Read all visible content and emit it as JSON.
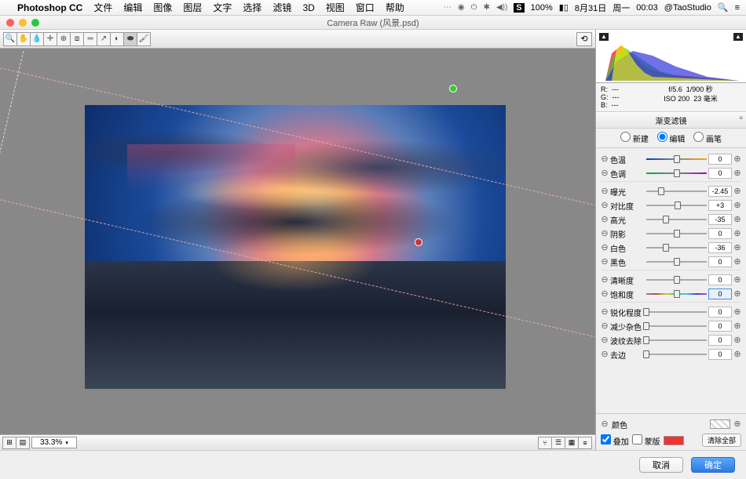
{
  "menubar": {
    "app": "Photoshop CC",
    "items": [
      "文件",
      "编辑",
      "图像",
      "图层",
      "文字",
      "选择",
      "滤镜",
      "3D",
      "视图",
      "窗口",
      "帮助"
    ],
    "status_icons": [
      "⋯",
      "◉",
      "⏻",
      "✱",
      "◀))",
      "S"
    ],
    "battery": "100%",
    "batt_icon": "▮▯",
    "date": "8月31日",
    "day": "周一",
    "time": "00:03",
    "user": "@TaoStudio"
  },
  "window": {
    "title": "Camera Raw (风景.psd)"
  },
  "toolbar": {
    "tools": [
      "zoom",
      "hand",
      "white-balance",
      "color-sampler",
      "target",
      "crop",
      "straighten",
      "spot",
      "redeye",
      "ellipse",
      "brush"
    ],
    "glyphs": [
      "🔍",
      "✋",
      "💧",
      "✛",
      "⊕",
      "⧈",
      "═",
      "↗",
      "◐",
      "⬬",
      "🖌"
    ],
    "selected_index": 9
  },
  "statusbar": {
    "grid_icons": [
      "⊞",
      "▤"
    ],
    "zoom": "33.3%",
    "right_icons": [
      "⑂",
      "☰",
      "▦",
      "≡"
    ]
  },
  "info": {
    "channels": [
      "R:",
      "G:",
      "B:"
    ],
    "dashes": "---",
    "aperture": "f/5.6",
    "shutter": "1/900 秒",
    "iso": "ISO 200",
    "focal": "23 毫米"
  },
  "panel": {
    "title": "渐变滤镜",
    "modes": {
      "new": "新建",
      "edit": "编辑",
      "brush": "画笔",
      "selected": "edit"
    }
  },
  "sliders": {
    "groups": [
      [
        {
          "key": "色温",
          "val": "0",
          "pos": 50,
          "track": "temp"
        },
        {
          "key": "色调",
          "val": "0",
          "pos": 50,
          "track": "tint"
        }
      ],
      [
        {
          "key": "曝光",
          "val": "-2.45",
          "pos": 25
        },
        {
          "key": "对比度",
          "val": "+3",
          "pos": 52
        },
        {
          "key": "高光",
          "val": "-35",
          "pos": 32
        },
        {
          "key": "阴影",
          "val": "0",
          "pos": 50
        },
        {
          "key": "白色",
          "val": "-36",
          "pos": 32
        },
        {
          "key": "黑色",
          "val": "0",
          "pos": 50
        }
      ],
      [
        {
          "key": "清晰度",
          "val": "0",
          "pos": 50
        },
        {
          "key": "饱和度",
          "val": "0",
          "pos": 50,
          "track": "sat",
          "active": true
        }
      ],
      [
        {
          "key": "锐化程度",
          "val": "0",
          "pos": 0
        },
        {
          "key": "减少杂色",
          "val": "0",
          "pos": 0
        },
        {
          "key": "波纹去除",
          "val": "0",
          "pos": 0
        },
        {
          "key": "去边",
          "val": "0",
          "pos": 0
        }
      ]
    ]
  },
  "bottom": {
    "color_label": "颜色",
    "overlay": "叠加",
    "mask": "蒙版",
    "clear": "清除全部"
  },
  "buttons": {
    "cancel": "取消",
    "ok": "确定"
  }
}
